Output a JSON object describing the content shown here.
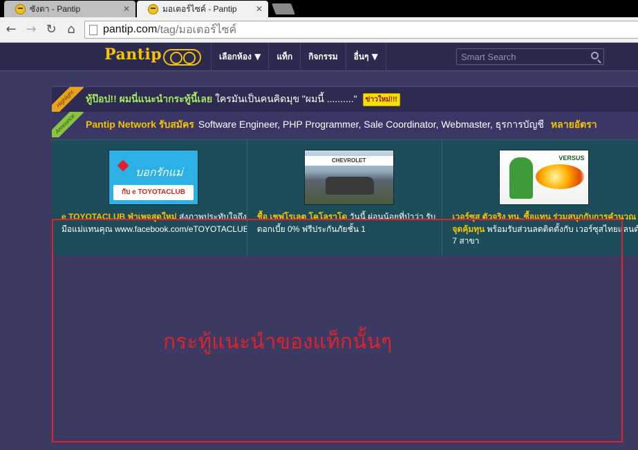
{
  "browser": {
    "tabs": [
      {
        "label": "ซังตา - Pantip",
        "active": false
      },
      {
        "label": "มอเตอร์ไซค์ - Pantip",
        "active": true
      }
    ],
    "url_domain": "pantip.com",
    "url_path": "/tag/มอเตอร์ไซค์",
    "nav_icons": {
      "back": "←",
      "forward": "→",
      "reload": "↻",
      "home": "⌂"
    }
  },
  "header": {
    "logo": "Pantip",
    "nav": [
      "เลือกห้อง ▼",
      "แท็ก",
      "กิจกรรม",
      "อื่นๆ ▼"
    ],
    "search_placeholder": "Smart Search"
  },
  "highlight": {
    "ribbon": "Highlight",
    "title": "ทู้ป๊อป!! ผมนี่แนะนำกระทู้นี้เลย",
    "text": "ใครมันเป็นคนคิดมุข \"ผมนี้ ..........\"",
    "badge": "ข่าวใหม่!!!"
  },
  "announce": {
    "ribbon": "Announce",
    "title": "Pantip Network รับสมัคร",
    "text": "Software Engineer, PHP Programmer, Sale Coordinator, Webmaster, ธุรการบัญชี",
    "link": "หลายอัตรา"
  },
  "ads": [
    {
      "title": "e TOYOTACLUB ฟ่าเพจสุดใหม่",
      "text": "ส่งภาพประทับใจถึงมือแม่แทนคุณ www.facebook.com/eTOYOTACLUB",
      "img_script": "บอกรักแม่",
      "img_caption": "กับ e TOYOTACLUB"
    },
    {
      "title": "ชื้อ เชฟโรเลต โคโลราโด",
      "text": "วันนี้ ผ่อนน้อยที่ป่าว่า รับดอกเบี้ย 0% ฟรีประกันภัยชั้น 1",
      "img_caption": "CHEVROLET"
    },
    {
      "title": "เวอร์ซุส ตัวจริง ทน..ซื้อแทน ร่วมสนุกกับการคำนวณ จุดคุ้มทุน",
      "text": "พร้อมรับส่วนลดติดตั้งกับ เวอร์ซุสไทยแลนด์ 7 สาขา",
      "img_caption": "VERSUS"
    }
  ],
  "annotation": {
    "text": "กระทู้แนะนำของแท็กนั้นๆ",
    "color": "#e0222a"
  },
  "colors": {
    "page_bg": "#3c3963",
    "header_bg": "#2d2a4f",
    "accent": "#f6c400",
    "ads_bg": "#1d4c5a"
  }
}
